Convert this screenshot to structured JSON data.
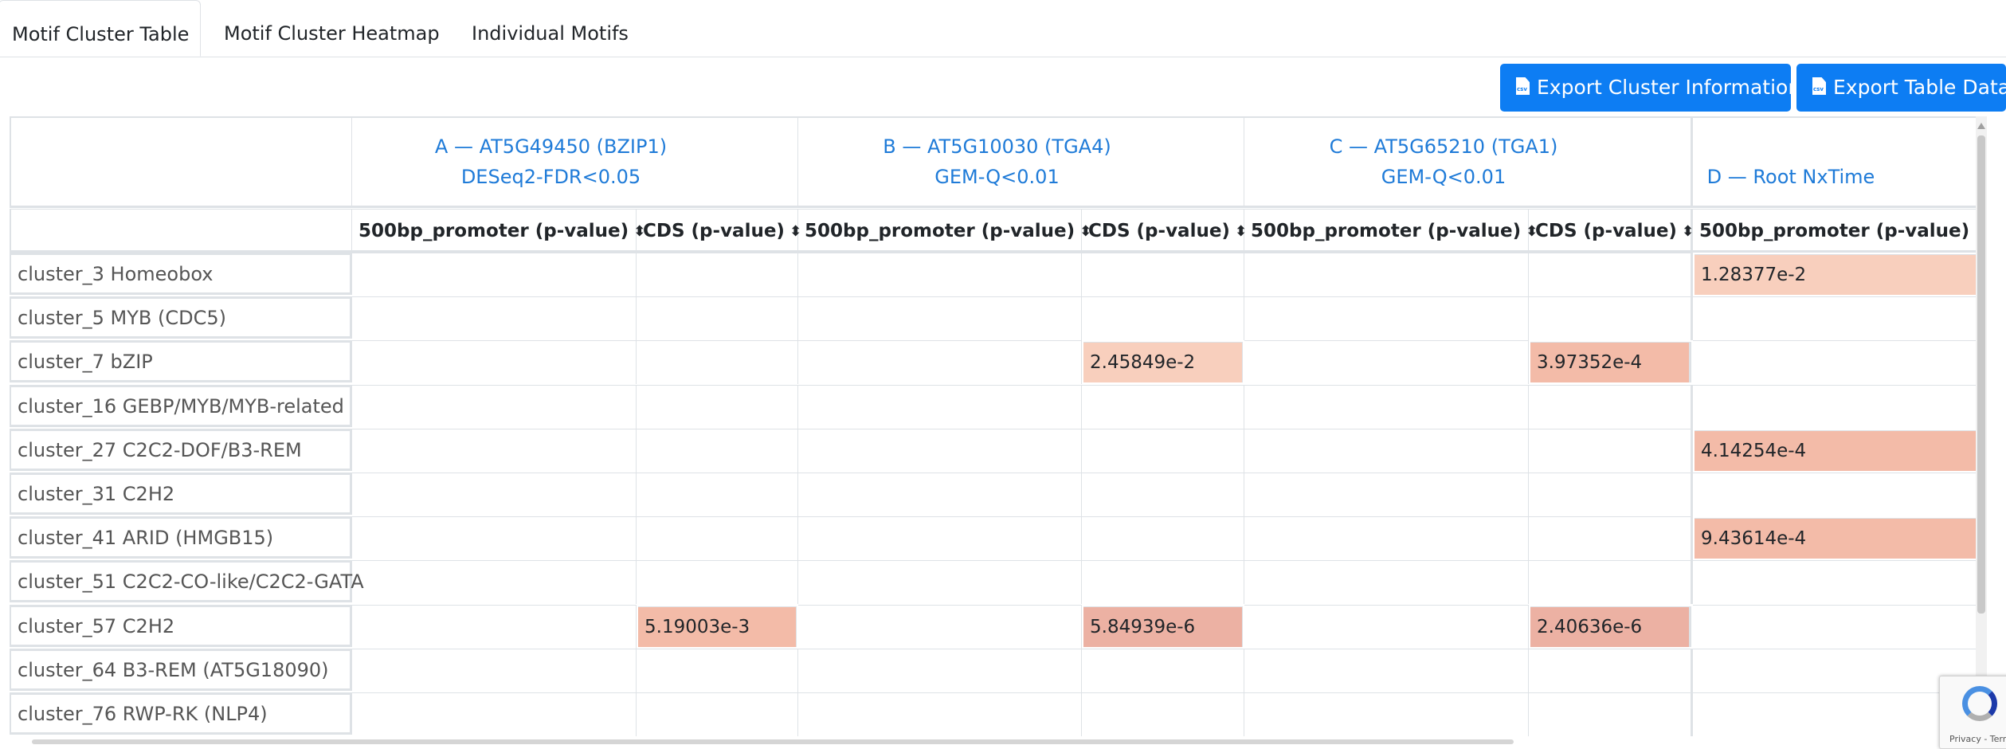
{
  "tabs": [
    {
      "label": "Motif Cluster Table",
      "active": true
    },
    {
      "label": "Motif Cluster Heatmap",
      "active": false
    },
    {
      "label": "Individual Motifs",
      "active": false
    }
  ],
  "buttons": {
    "export_cluster": "Export Cluster Information",
    "export_table": "Export Table Data",
    "icon_text": "csv"
  },
  "table": {
    "groups": [
      {
        "line1": "A — AT5G49450 (BZIP1)",
        "line2": "DESeq2-FDR<0.05"
      },
      {
        "line1": "B — AT5G10030 (TGA4)",
        "line2": "GEM-Q<0.01"
      },
      {
        "line1": "C — AT5G65210 (TGA1)",
        "line2": "GEM-Q<0.01"
      },
      {
        "line1": "D — Root NxTime",
        "line2": ""
      }
    ],
    "columns": [
      "500bp_promoter (p-value)",
      "CDS (p-value)",
      "500bp_promoter (p-value)",
      "CDS (p-value)",
      "500bp_promoter (p-value)",
      "CDS (p-value)",
      "500bp_promoter (p-value)"
    ],
    "rows": [
      {
        "label": "cluster_3 Homeobox",
        "values": [
          "",
          "",
          "",
          "",
          "",
          "",
          "1.28377e-2"
        ]
      },
      {
        "label": "cluster_5 MYB (CDC5)",
        "values": [
          "",
          "",
          "",
          "",
          "",
          "",
          ""
        ]
      },
      {
        "label": "cluster_7 bZIP",
        "values": [
          "",
          "",
          "",
          "2.45849e-2",
          "",
          "3.97352e-4",
          ""
        ]
      },
      {
        "label": "cluster_16 GEBP/MYB/MYB-related",
        "values": [
          "",
          "",
          "",
          "",
          "",
          "",
          ""
        ]
      },
      {
        "label": "cluster_27 C2C2-DOF/B3-REM",
        "values": [
          "",
          "",
          "",
          "",
          "",
          "",
          "4.14254e-4"
        ]
      },
      {
        "label": "cluster_31 C2H2",
        "values": [
          "",
          "",
          "",
          "",
          "",
          "",
          ""
        ]
      },
      {
        "label": "cluster_41 ARID (HMGB15)",
        "values": [
          "",
          "",
          "",
          "",
          "",
          "",
          "9.43614e-4"
        ]
      },
      {
        "label": "cluster_51 C2C2-CO-like/C2C2-GATA",
        "values": [
          "",
          "",
          "",
          "",
          "",
          "",
          ""
        ]
      },
      {
        "label": "cluster_57 C2H2",
        "values": [
          "",
          "5.19003e-3",
          "",
          "5.84939e-6",
          "",
          "2.40636e-6",
          ""
        ]
      },
      {
        "label": "cluster_64 B3-REM (AT5G18090)",
        "values": [
          "",
          "",
          "",
          "",
          "",
          "",
          ""
        ]
      },
      {
        "label": "cluster_76 RWP-RK (NLP4)",
        "values": [
          "",
          "",
          "",
          "",
          "",
          "",
          ""
        ]
      }
    ]
  },
  "colors": {
    "accent": "#0d7df3",
    "link": "#1f7bd8",
    "heat_light": "#f8cfbd",
    "heat_mid": "#f3bba8",
    "heat_strong": "#ecb1a3"
  },
  "recaptcha": {
    "text": "Privacy - Terms"
  }
}
